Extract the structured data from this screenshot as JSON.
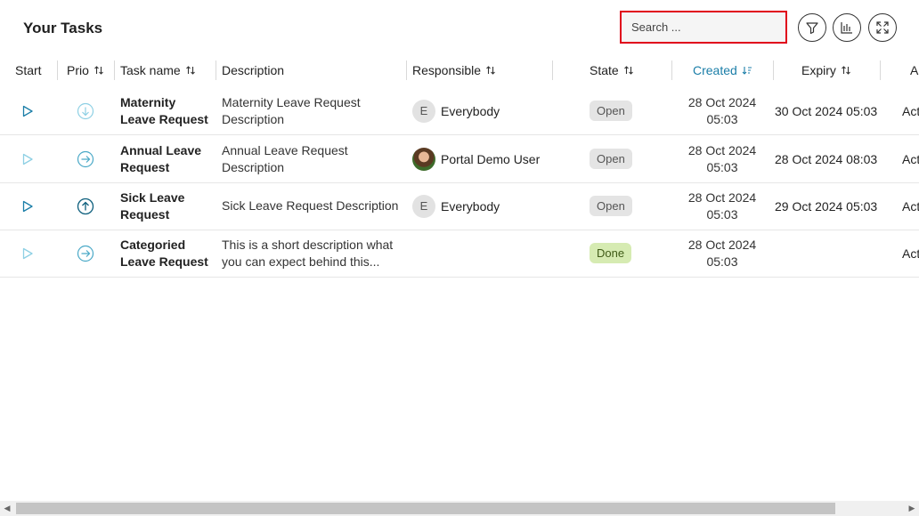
{
  "page": {
    "title": "Your Tasks"
  },
  "search": {
    "placeholder": "Search ..."
  },
  "toolbar": {
    "filter_icon": "filter-icon",
    "columns_icon": "columns-icon",
    "expand_icon": "expand-icon"
  },
  "columns": {
    "start": "Start",
    "prio": "Prio",
    "task_name": "Task name",
    "description": "Description",
    "responsible": "Responsible",
    "state": "State",
    "created": "Created",
    "expiry": "Expiry",
    "actions": "A"
  },
  "colors": {
    "accent": "#1b7ea8",
    "highlight_border": "#e0001b",
    "done_badge": "#d6ebb2",
    "open_badge": "#e4e4e4"
  },
  "tasks": [
    {
      "name_line1": "Maternity",
      "name_line2": "Leave Request",
      "desc_line1": "Maternity Leave Request",
      "desc_line2": "Description",
      "responsible_initial": "E",
      "responsible": "Everybody",
      "state": "Open",
      "created_date": "28 Oct 2024",
      "created_time": "05:03",
      "expiry": "30 Oct 2024 05:03",
      "actions": "Act",
      "priority": "low"
    },
    {
      "name_line1": "Annual Leave",
      "name_line2": "Request",
      "desc_line1": "Annual Leave Request",
      "desc_line2": "Description",
      "responsible_initial": "",
      "responsible": "Portal Demo User",
      "state": "Open",
      "created_date": "28 Oct 2024",
      "created_time": "05:03",
      "expiry": "28 Oct 2024 08:03",
      "actions": "Act",
      "priority": "normal"
    },
    {
      "name_line1": "Sick Leave",
      "name_line2": "Request",
      "desc_line1": "Sick Leave Request Description",
      "desc_line2": "",
      "responsible_initial": "E",
      "responsible": "Everybody",
      "state": "Open",
      "created_date": "28 Oct 2024",
      "created_time": "05:03",
      "expiry": "29 Oct 2024 05:03",
      "actions": "Act",
      "priority": "high"
    },
    {
      "name_line1": "Categoried",
      "name_line2": "Leave Request",
      "desc_line1": "This is a short description what",
      "desc_line2": "you can expect behind this...",
      "responsible_initial": "",
      "responsible": "",
      "state": "Done",
      "created_date": "28 Oct 2024",
      "created_time": "05:03",
      "expiry": "",
      "actions": "Act",
      "priority": "normal"
    }
  ]
}
